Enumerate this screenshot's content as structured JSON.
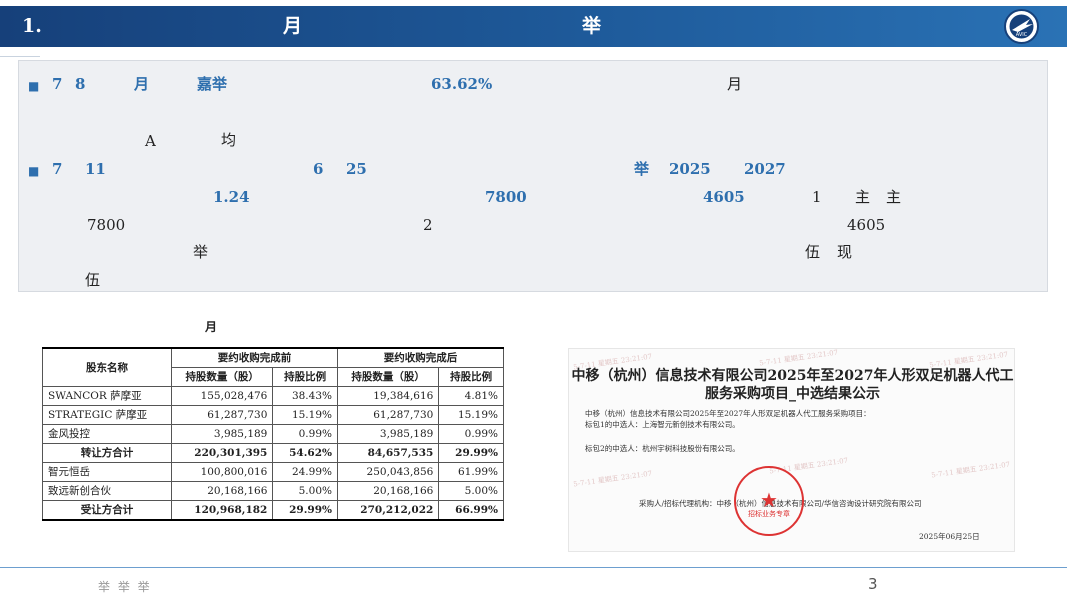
{
  "header": {
    "section": "1.",
    "word1": "月",
    "word2": "举",
    "logo_text": "AVIC"
  },
  "bullets": {
    "line1": [
      "■",
      "7",
      "8",
      "月",
      "嘉举",
      "63.62%",
      "月"
    ],
    "line2": [
      "A",
      "均"
    ],
    "line3": [
      "■",
      "7",
      "11",
      "6",
      "25",
      "举",
      "2025",
      "2027"
    ],
    "line4": [
      "1.24",
      "7800",
      "4605",
      "1",
      "主",
      "主"
    ],
    "line5": [
      "7800",
      "2",
      "4605"
    ],
    "line6": [
      "举",
      "伍",
      "现"
    ],
    "line7": [
      "伍"
    ]
  },
  "caption": "月",
  "table": {
    "col_name": "股东名称",
    "group_before": "要约收购完成前",
    "group_after": "要约收购完成后",
    "sub_qty": "持股数量（股）",
    "sub_ratio": "持股比例",
    "rows": [
      {
        "name": "SWANCOR 萨摩亚",
        "q1": "155,028,476",
        "r1": "38.43%",
        "q2": "19,384,616",
        "r2": "4.81%"
      },
      {
        "name": "STRATEGIC 萨摩亚",
        "q1": "61,287,730",
        "r1": "15.19%",
        "q2": "61,287,730",
        "r2": "15.19%"
      },
      {
        "name": "金风投控",
        "q1": "3,985,189",
        "r1": "0.99%",
        "q2": "3,985,189",
        "r2": "0.99%"
      },
      {
        "name": "转让方合计",
        "q1": "220,301,395",
        "r1": "54.62%",
        "q2": "84,657,535",
        "r2": "29.99%"
      },
      {
        "name": "智元恒岳",
        "q1": "100,800,016",
        "r1": "24.99%",
        "q2": "250,043,856",
        "r2": "61.99%"
      },
      {
        "name": "致远新创合伙",
        "q1": "20,168,166",
        "r1": "5.00%",
        "q2": "20,168,166",
        "r2": "5.00%"
      },
      {
        "name": "受让方合计",
        "q1": "120,968,182",
        "r1": "29.99%",
        "q2": "270,212,022",
        "r2": "66.99%"
      }
    ]
  },
  "notice": {
    "title1": "中移（杭州）信息技术有限公司2025年至2027年人形双足机器人代工",
    "title2": "服务采购项目_中选结果公示",
    "line1": "中移（杭州）信息技术有限公司2025年至2027年人形双足机器人代工服务采购项目：",
    "line2": "标包1的中选人：上海智元新创技术有限公司。",
    "line3": "标包2的中选人：杭州宇树科技股份有限公司。",
    "line4": "采购人/招标代理机构：中移（杭州）信息技术有限公司/华信咨询设计研究院有限公司",
    "date": "2025年06月25日",
    "watermark": "5-7-11 星期五 23:21:07",
    "seal_text": "招标业务专章"
  },
  "footer": {
    "text": "举 举  举",
    "page": "3"
  }
}
